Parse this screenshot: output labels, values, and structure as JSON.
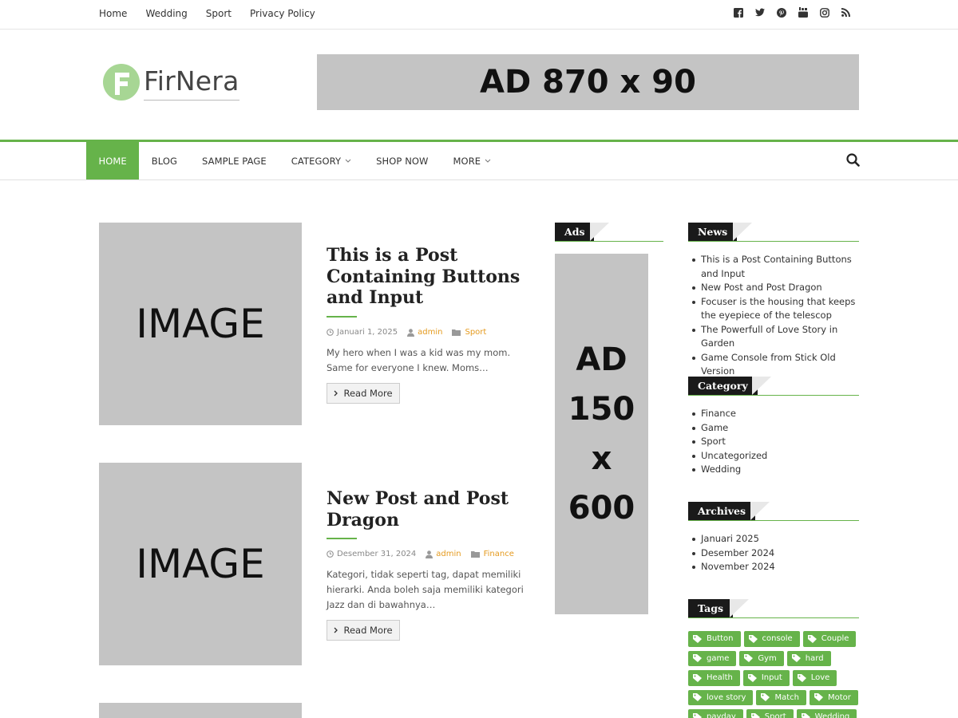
{
  "topbar": {
    "links": [
      "Home",
      "Wedding",
      "Sport",
      "Privacy Policy"
    ],
    "social_icons": [
      "facebook-icon",
      "twitter-icon",
      "pinterest-icon",
      "youtube-icon",
      "instagram-icon",
      "rss-icon"
    ]
  },
  "header": {
    "logo_text": "FirNera",
    "ad_text": "AD 870 x 90"
  },
  "nav": {
    "items": [
      {
        "label": "HOME",
        "active": true
      },
      {
        "label": "BLOG"
      },
      {
        "label": "SAMPLE PAGE"
      },
      {
        "label": "CATEGORY",
        "dropdown": true
      },
      {
        "label": "SHOP NOW"
      },
      {
        "label": "MORE",
        "dropdown": true
      }
    ],
    "accent": "#66b34a"
  },
  "posts": [
    {
      "image_text": "IMAGE",
      "title": "This is a Post Containing Buttons and Input",
      "date": "Januari 1, 2025",
      "author": "admin",
      "category": "Sport",
      "excerpt": "My hero when I was a kid was my mom. Same for everyone I knew. Moms…",
      "read_more": "Read More"
    },
    {
      "image_text": "IMAGE",
      "title": "New Post and Post Dragon",
      "date": "Desember 31, 2024",
      "author": "admin",
      "category": "Finance",
      "excerpt": "Kategori, tidak seperti tag, dapat memiliki hierarki. Anda boleh saja memiliki kategori Jazz dan di bawahnya…",
      "read_more": "Read More"
    }
  ],
  "sidebar_ads": {
    "title": "Ads",
    "ad_lines": [
      "AD",
      "150",
      "x",
      "600"
    ]
  },
  "widgets": {
    "news": {
      "title": "News",
      "items": [
        "This is a Post Containing Buttons and Input",
        "New Post and Post Dragon",
        "Focuser is the housing that keeps the eyepiece of the telescop",
        "The Powerfull of Love Story in Garden",
        "Game Console from Stick Old Version"
      ]
    },
    "category": {
      "title": "Category",
      "items": [
        "Finance",
        "Game",
        "Sport",
        "Uncategorized",
        "Wedding"
      ]
    },
    "archives": {
      "title": "Archives",
      "items": [
        "Januari 2025",
        "Desember 2024",
        "November 2024"
      ]
    },
    "tags": {
      "title": "Tags",
      "items": [
        "Button",
        "console",
        "Couple",
        "game",
        "Gym",
        "hard",
        "Health",
        "Input",
        "Love",
        "love story",
        "Match",
        "Motor",
        "payday",
        "Sport",
        "Wedding"
      ]
    }
  }
}
